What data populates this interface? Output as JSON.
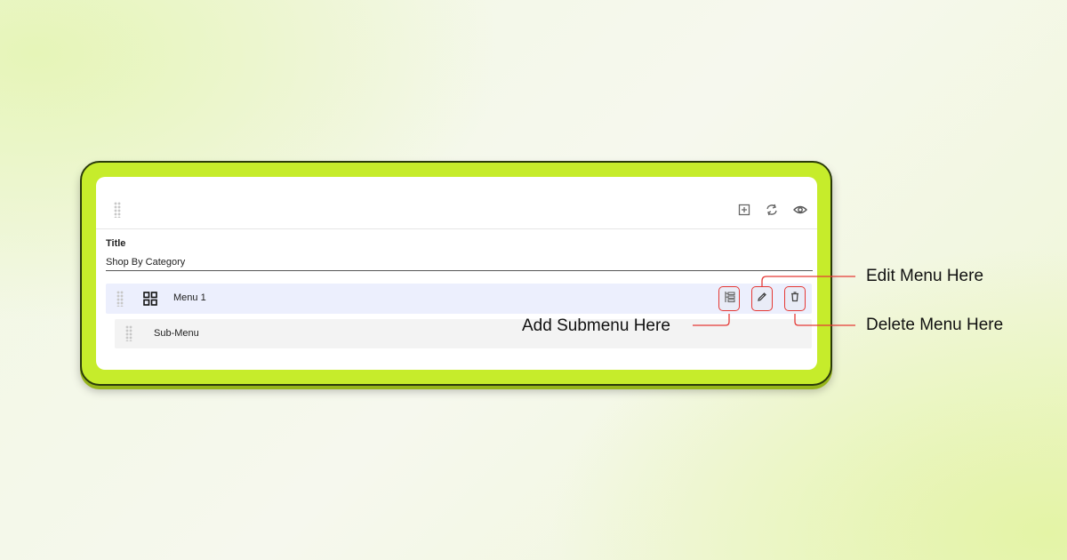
{
  "panel": {
    "toolbar_icons": [
      "add-box-icon",
      "refresh-icon",
      "eye-icon"
    ],
    "title_label": "Title",
    "title_value": "Shop By Category",
    "menu_item": {
      "label": "Menu 1",
      "icon": "grid-icon",
      "actions": [
        "add-submenu-icon",
        "edit-pencil-icon",
        "delete-trash-icon"
      ]
    },
    "submenu_item": {
      "label": "Sub-Menu"
    }
  },
  "callouts": {
    "edit": "Edit Menu Here",
    "add_submenu": "Add Submenu Here",
    "delete": "Delete Menu Here"
  },
  "colors": {
    "frame_accent": "#c6ec2b",
    "callout_line": "#e53935",
    "menu_row_bg": "#eceffd"
  }
}
